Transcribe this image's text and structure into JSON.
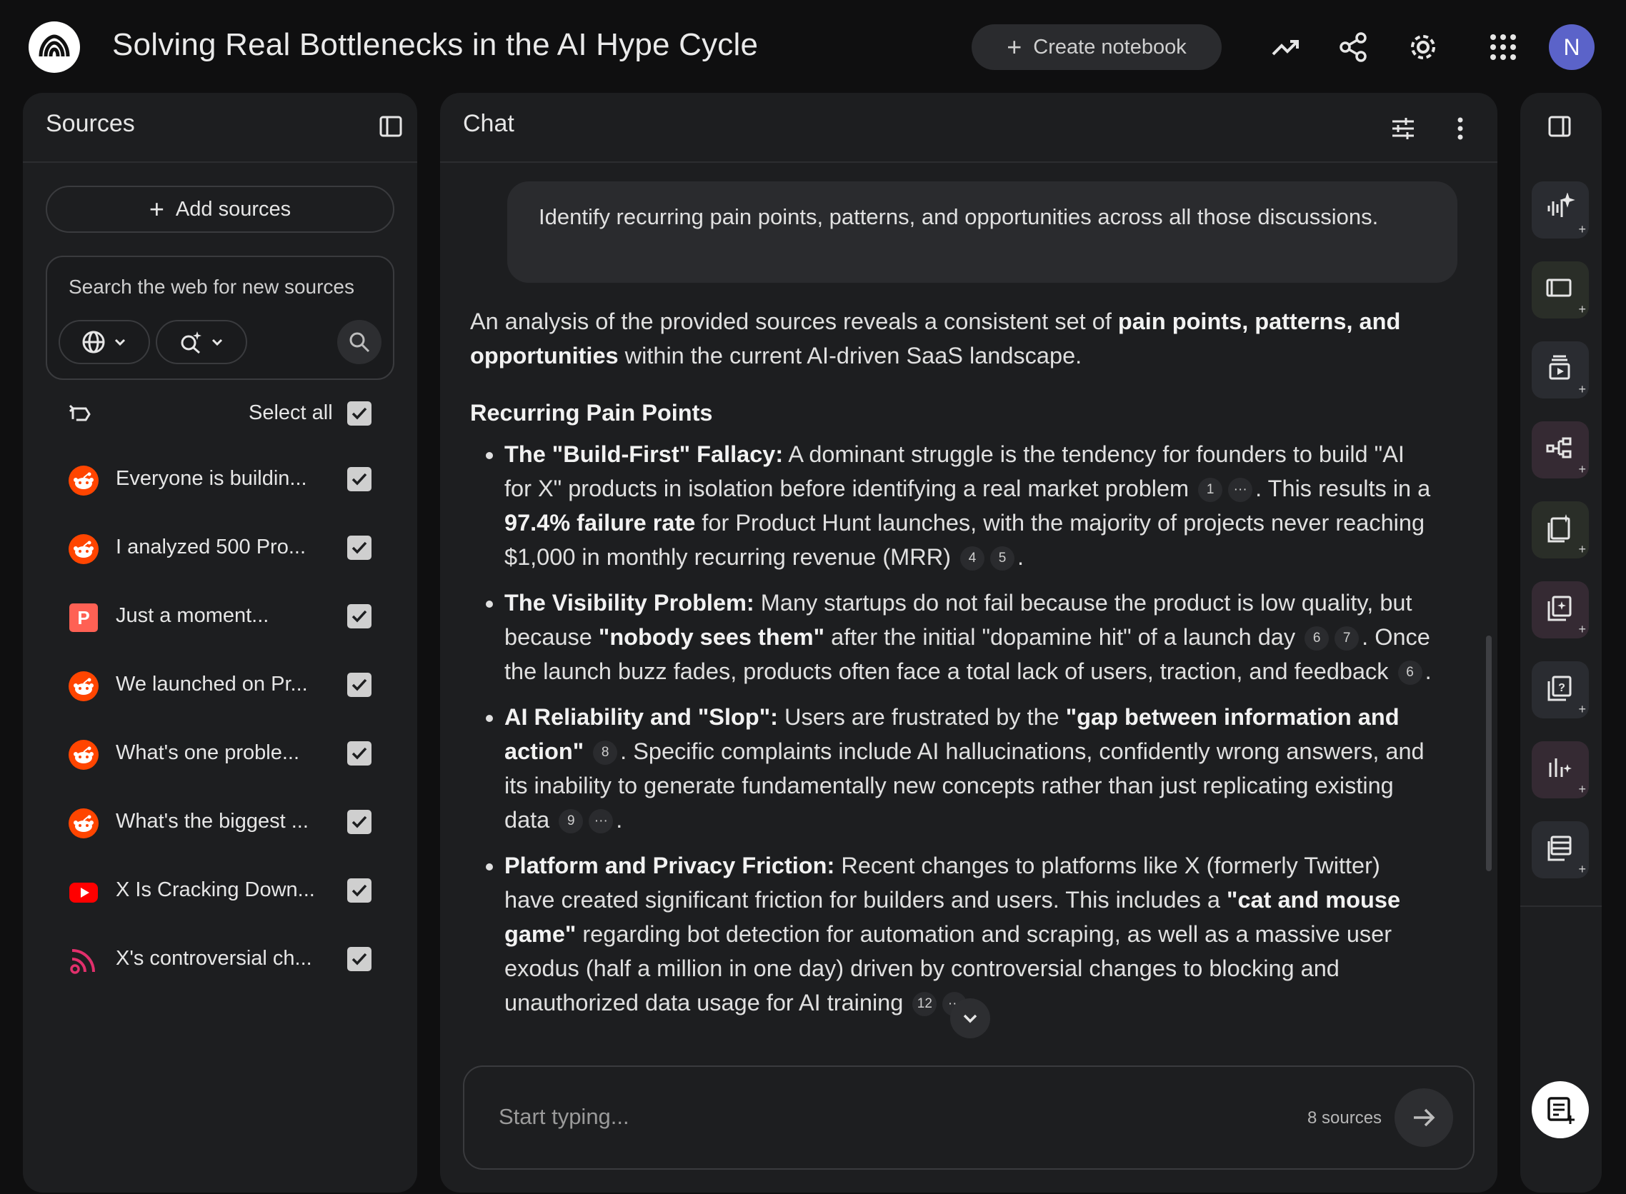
{
  "header": {
    "title": "Solving Real Bottlenecks in the AI Hype Cycle",
    "create_notebook_label": "Create notebook",
    "avatar_initial": "N",
    "icons": [
      "analytics-icon",
      "share-icon",
      "settings-icon",
      "apps-grid-icon"
    ]
  },
  "sources_panel": {
    "title": "Sources",
    "add_sources_label": "Add sources",
    "search_placeholder": "Search the web for new sources",
    "select_all_label": "Select all",
    "items": [
      {
        "label": "Everyone is buildin...",
        "icon": "reddit-icon",
        "checked": true
      },
      {
        "label": "I analyzed 500 Pro...",
        "icon": "reddit-icon",
        "checked": true
      },
      {
        "label": "Just a moment...",
        "icon": "producthunt-icon",
        "checked": true
      },
      {
        "label": "We launched on Pr...",
        "icon": "reddit-icon",
        "checked": true
      },
      {
        "label": "What's one proble...",
        "icon": "reddit-icon",
        "checked": true
      },
      {
        "label": "What's the biggest ...",
        "icon": "reddit-icon",
        "checked": true
      },
      {
        "label": "X Is Cracking Down...",
        "icon": "youtube-icon",
        "checked": true
      },
      {
        "label": "X's controversial ch...",
        "icon": "rss-feed-icon",
        "checked": true
      }
    ]
  },
  "chat": {
    "title": "Chat",
    "user_message": "Identify recurring pain points, patterns, and opportunities across all those discussions.",
    "intro_a": "An analysis of the provided sources reveals a consistent set of ",
    "intro_b": "pain points, patterns, and opportunities",
    "intro_c": " within the current AI-driven SaaS landscape.",
    "heading": "Recurring Pain Points",
    "bullets": [
      {
        "t1": "The \"Build-First\" Fallacy:",
        "t2": " A dominant struggle is the tendency for founders to build \"AI for X\" products in isolation before identifying a real market problem",
        "c1": "1",
        "c2": "···",
        "t3": ". This results in a ",
        "t4": "97.4% failure rate",
        "t5": " for Product Hunt launches, with the majority of projects never reaching $1,000 in monthly recurring revenue (MRR)",
        "c3": "4",
        "c4": "5",
        "t6": "."
      },
      {
        "t1": "The Visibility Problem:",
        "t2": " Many startups do not fail because the product is low quality, but because ",
        "t3": "\"nobody sees them\"",
        "t4": " after the initial \"dopamine hit\" of a launch day",
        "c1": "6",
        "c2": "7",
        "t5": ". Once the launch buzz fades, products often face a total lack of users, traction, and feedback",
        "c3": "6",
        "t6": "."
      },
      {
        "t1": "AI Reliability and \"Slop\":",
        "t2": " Users are frustrated by the ",
        "t3": "\"gap between information and action\"",
        "c1": "8",
        "t4": ". Specific complaints include AI hallucinations, confidently wrong answers, and its inability to generate fundamentally new concepts rather than just replicating existing data",
        "c2": "9",
        "c3": "···",
        "t5": "."
      },
      {
        "t1": "Platform and Privacy Friction:",
        "t2": " Recent changes to platforms like X (formerly Twitter) have created significant friction for builders and users. This includes a ",
        "t3": "\"cat and mouse game\"",
        "t4": " regarding bot detection for automation and scraping, as well as a massive user exodus (half a million in one day) driven by controversial changes to blocking and unauthorized data usage for AI training",
        "c1": "12",
        "c2": "···",
        "t5": "."
      }
    ],
    "composer_placeholder": "Start typing...",
    "source_count": "8 sources"
  },
  "studio": {
    "tools": [
      "audio-overview-icon",
      "video-overview-icon",
      "slides-icon",
      "mind-map-icon",
      "report-icon",
      "flashcards-icon",
      "quiz-icon",
      "infographic-icon",
      "data-table-icon"
    ],
    "tool_colors": [
      "#2a2c31",
      "#2a2e28",
      "#2a2c31",
      "#352a33",
      "#2a2e28",
      "#352a33",
      "#2a2c31",
      "#352a33",
      "#2a2c31"
    ]
  },
  "colors": {
    "background": "#0f0f10",
    "panel": "#1d1e20",
    "reddit": "#ff4500",
    "producthunt": "#ff6154",
    "youtube": "#ff0000",
    "avatar": "#5b63c9"
  }
}
